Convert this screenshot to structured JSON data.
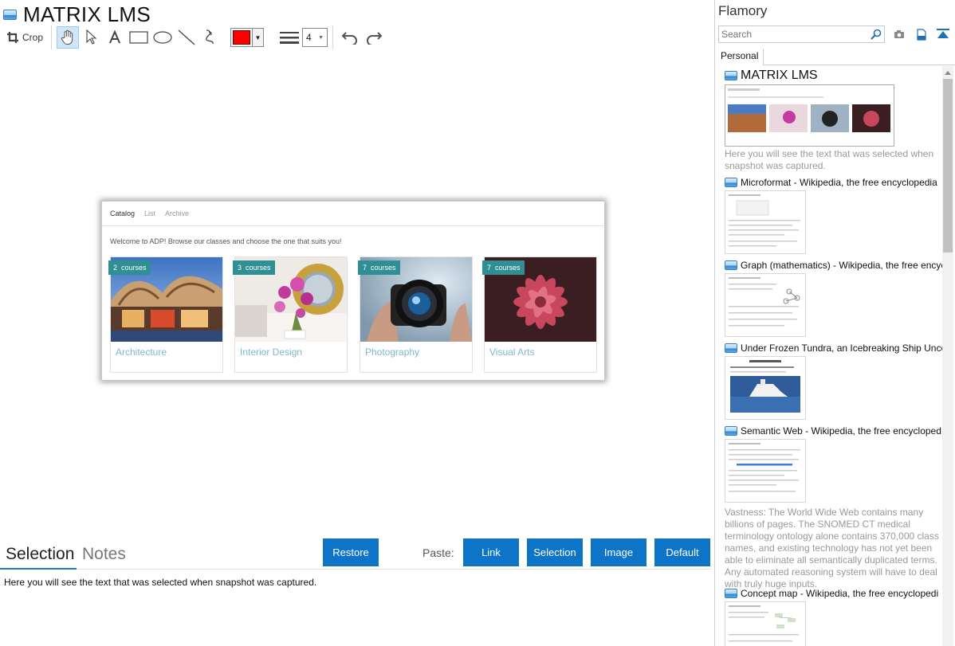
{
  "document": {
    "title": "MATRIX LMS"
  },
  "toolbar": {
    "crop_label": "Crop",
    "stroke_width": "4",
    "stroke_color": "#ff0000"
  },
  "snapshot": {
    "tabs": [
      "Catalog",
      "List",
      "Archive"
    ],
    "welcome": "Welcome to ADP! Browse our classes and choose the one that suits you!",
    "cards": [
      {
        "badge": "2  courses",
        "name": "Architecture"
      },
      {
        "badge": "3  courses",
        "name": "Interior Design"
      },
      {
        "badge": "7  courses",
        "name": "Photography"
      },
      {
        "badge": "7  courses",
        "name": "Visual Arts"
      }
    ]
  },
  "bottom": {
    "tab_selection": "Selection",
    "tab_notes": "Notes",
    "restore": "Restore",
    "paste_label": "Paste:",
    "link": "Link",
    "selection": "Selection",
    "image": "Image",
    "default": "Default",
    "selection_text": "Here you will see the text that was selected when snapshot was captured."
  },
  "sidebar": {
    "title": "Flamory",
    "search_placeholder": "Search",
    "tab": "Personal",
    "entries": [
      {
        "title": "MATRIX LMS",
        "desc": "Here you will see the text that was selected when snapshot was captured."
      },
      {
        "title": "Microformat - Wikipedia, the free encyclopedia"
      },
      {
        "title": "Graph (mathematics) - Wikipedia, the free encyc"
      },
      {
        "title": "Under Frozen Tundra, an Icebreaking Ship Unco"
      },
      {
        "title": "Semantic Web - Wikipedia, the free encycloped",
        "desc": "Vastness: The World Wide Web contains many billions of pages. The SNOMED CT medical terminology ontology alone contains 370,000 class names, and existing technology has not yet been able to eliminate all semantically duplicated terms. Any automated reasoning system will have to deal with truly huge inputs."
      },
      {
        "title": "Concept map - Wikipedia, the free encyclopedi"
      }
    ]
  },
  "colors": {
    "accent": "#0e74c8",
    "badge": "#2f8f92",
    "card_text": "#7cb8c9"
  }
}
